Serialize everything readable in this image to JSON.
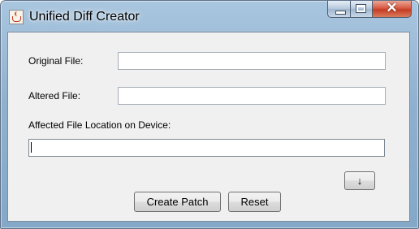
{
  "window": {
    "title": "Unified Diff Creator",
    "close_glyph": "✕"
  },
  "icons": {
    "app": "java-cup-icon",
    "arrow": "↓"
  },
  "form": {
    "original_label": "Original File:",
    "original_value": "",
    "altered_label": "Altered File:",
    "altered_value": "",
    "location_label": "Affected File Location on Device:",
    "location_value": ""
  },
  "buttons": {
    "create_patch": "Create Patch",
    "reset": "Reset"
  }
}
